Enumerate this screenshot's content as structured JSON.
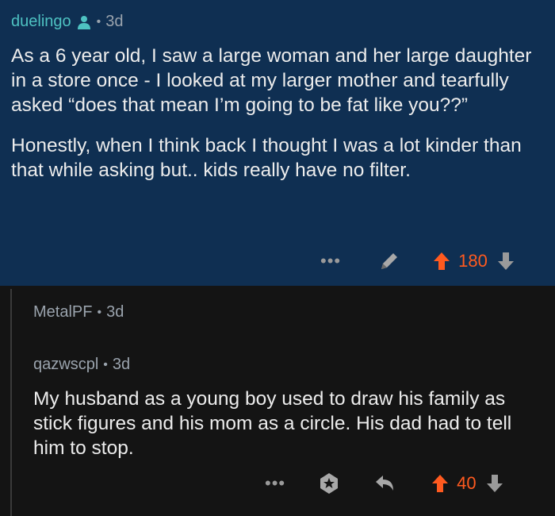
{
  "comments": [
    {
      "username": "duelingo",
      "separator": "•",
      "age": "3d",
      "paragraphs": [
        "As a 6 year old, I saw a large woman and her large daughter in a store once - I looked at my larger mother and tearfully asked “does that mean I’m going to be fat like you??”",
        "Honestly, when I think back I thought I was a lot kinder than that while asking but.. kids really have no filter."
      ],
      "more": "•••",
      "score": "180"
    },
    {
      "username": "MetalPF",
      "separator": "•",
      "age": "3d"
    },
    {
      "username": "qazwscpl",
      "separator": "•",
      "age": "3d",
      "paragraphs": [
        "My husband as a young boy used to draw his family as stick figures and his mom as a circle. His dad had to tell him to stop."
      ],
      "more": "•••",
      "score": "40"
    }
  ],
  "colors": {
    "op_username": "#4ec2c2",
    "top_background": "#0f2f52",
    "page_background": "#141414",
    "score": "#ff5a1f"
  },
  "icons": [
    "person-icon",
    "pencil-icon",
    "upvote-arrow-icon",
    "downvote-arrow-icon",
    "award-icon",
    "reply-icon"
  ]
}
